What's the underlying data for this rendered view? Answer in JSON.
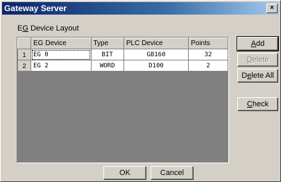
{
  "window": {
    "title": "Gateway Server",
    "close_label": "×"
  },
  "group_label": {
    "prefix": "E",
    "mnemonic": "G",
    "suffix": " Device Layout"
  },
  "table": {
    "headers": [
      "",
      "EG Device",
      "Type",
      "PLC Device",
      "Points"
    ],
    "rows": [
      {
        "num": "1",
        "device": "EG  0",
        "type": "BIT",
        "plc": "GB160",
        "points": "32"
      },
      {
        "num": "2",
        "device": "EG  2",
        "type": "WORD",
        "plc": "D100",
        "points": "2"
      }
    ]
  },
  "buttons": {
    "add": {
      "mnemonic": "A",
      "rest": "dd"
    },
    "delete": {
      "mnemonic": "D",
      "rest": "elete"
    },
    "delete_all": {
      "pre": "D",
      "mnemonic": "e",
      "rest": "lete All"
    },
    "check": {
      "mnemonic": "C",
      "rest": "heck"
    },
    "ok": "OK",
    "cancel": "Cancel"
  }
}
